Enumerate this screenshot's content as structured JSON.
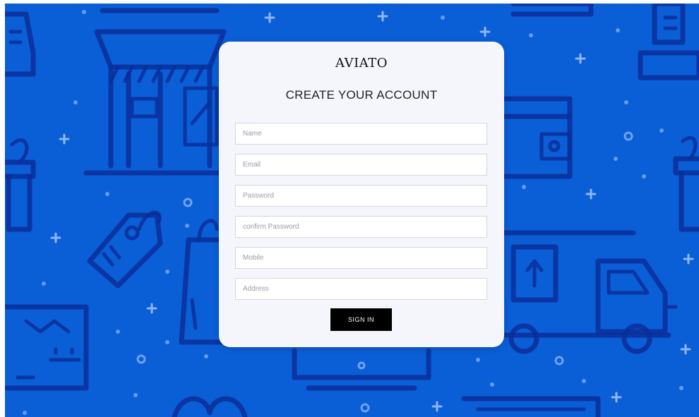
{
  "brand": "AVIATO",
  "heading": "CREATE YOUR ACCOUNT",
  "fields": [
    {
      "placeholder": "Name",
      "value": ""
    },
    {
      "placeholder": "Email",
      "value": ""
    },
    {
      "placeholder": "Password",
      "value": ""
    },
    {
      "placeholder": "confirm Password",
      "value": ""
    },
    {
      "placeholder": "Mobile",
      "value": ""
    },
    {
      "placeholder": "Address",
      "value": ""
    }
  ],
  "submit_label": "SIGN IN",
  "colors": {
    "background": "#0a5ed6",
    "pattern": "#0b2e99",
    "card": "#f5f6fb",
    "button": "#000000"
  },
  "background_icons": [
    "shop-icon",
    "price-tag-icon",
    "shopping-bag-icon",
    "wallet-icon",
    "delivery-truck-icon",
    "parcel-box-icon",
    "gift-icon",
    "cash-register-icon",
    "receipt-icon"
  ]
}
